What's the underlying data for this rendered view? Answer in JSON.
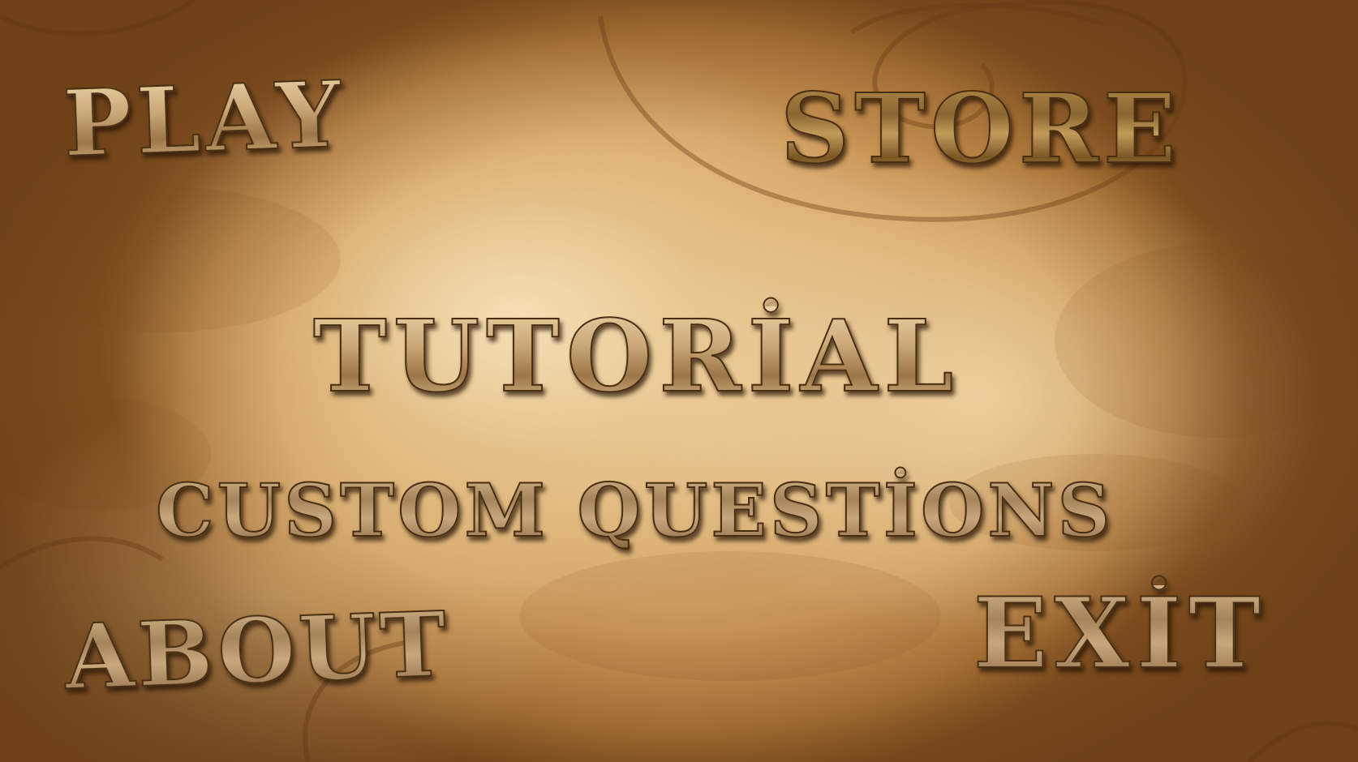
{
  "menu": {
    "play": "PLAY",
    "store": "STORE",
    "tutorial": "TUTORİAL",
    "custom_questions": "CUSTOM QUESTİONS",
    "about": "ABOUT",
    "exit": "EXİT"
  },
  "colors": {
    "parchment_light": "#e7c58f",
    "parchment_dark": "#8e5a26",
    "text_outline": "#4a2e12"
  }
}
